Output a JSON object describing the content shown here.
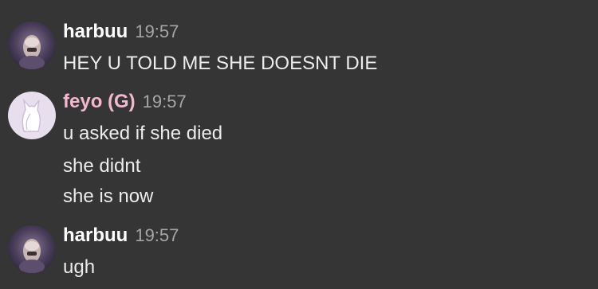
{
  "colors": {
    "background": "#353535",
    "username_default": "#ffffff",
    "username_pink": "#f2b8cf",
    "timestamp": "#a6a6a6",
    "message_text": "#ececec"
  },
  "messages": [
    {
      "username": "harbuu",
      "timestamp": "19:57",
      "avatar_icon": "user-avatar-icon",
      "lines": [
        "HEY U TOLD ME SHE DOESNT DIE"
      ]
    },
    {
      "username": "feyo (G)",
      "timestamp": "19:57",
      "avatar_icon": "cat-silhouette-avatar-icon",
      "lines": [
        "u asked if she died",
        "she didnt",
        "she is now"
      ]
    },
    {
      "username": "harbuu",
      "timestamp": "19:57",
      "avatar_icon": "user-avatar-icon",
      "lines": [
        "ugh"
      ]
    }
  ]
}
